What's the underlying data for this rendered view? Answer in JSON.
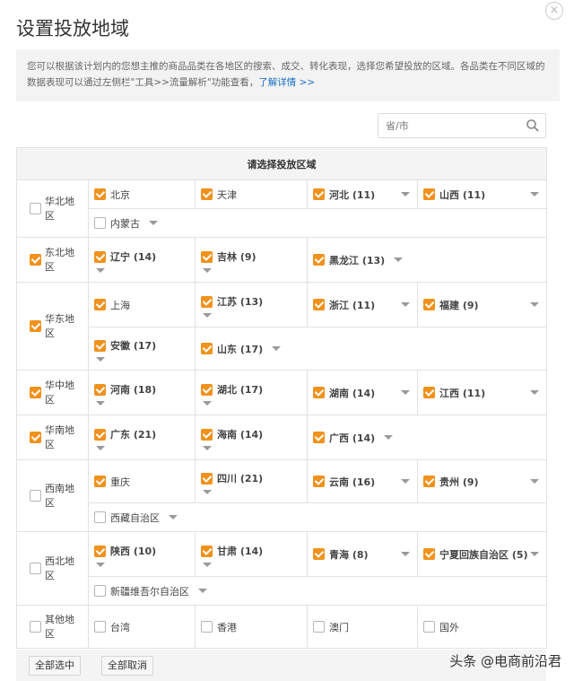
{
  "dialog": {
    "title": "设置投放地域",
    "close_glyph": "×",
    "notice_text": "您可以根据该计划内的您想主推的商品品类在各地区的搜索、成交、转化表现，选择您希望投放的区域。各品类在不同区域的数据表现可以通过左侧栏\"工具>>流量解析\"功能查看，",
    "notice_link": "了解详情 >>",
    "search_placeholder": "省/市",
    "table_header": "请选择投放区域",
    "select_all_label": "全部选中",
    "cancel_all_label": "全部取消",
    "watermark": "头条 @电商前沿君"
  },
  "groups": [
    {
      "label": "华北地区",
      "checked": false,
      "rows": [
        [
          {
            "name": "北京",
            "count": "",
            "checked": true,
            "caret": "none"
          },
          {
            "name": "天津",
            "count": "",
            "checked": true,
            "caret": "none"
          },
          {
            "name": "河北 (11)",
            "count": "",
            "checked": true,
            "caret": "right"
          },
          {
            "name": "山西 (11)",
            "count": "",
            "checked": true,
            "caret": "right"
          }
        ],
        [
          {
            "name": "内蒙古",
            "checked": false,
            "caret": "inline"
          }
        ]
      ]
    },
    {
      "label": "东北地区",
      "checked": true,
      "rows": [
        [
          {
            "name": "辽宁 (14)",
            "checked": true,
            "caret": "below"
          },
          {
            "name": "吉林 (9)",
            "checked": true,
            "caret": "below"
          },
          {
            "name": "黑龙江 (13)",
            "checked": true,
            "caret": "inline"
          }
        ]
      ]
    },
    {
      "label": "华东地区",
      "checked": true,
      "rows": [
        [
          {
            "name": "上海",
            "checked": true,
            "caret": "none"
          },
          {
            "name": "江苏 (13)",
            "checked": true,
            "caret": "below"
          },
          {
            "name": "浙江 (11)",
            "checked": true,
            "caret": "right"
          },
          {
            "name": "福建 (9)",
            "checked": true,
            "caret": "right"
          }
        ],
        [
          {
            "name": "安徽 (17)",
            "checked": true,
            "caret": "below"
          },
          {
            "name": "山东 (17)",
            "checked": true,
            "caret": "inline"
          }
        ]
      ]
    },
    {
      "label": "华中地区",
      "checked": true,
      "rows": [
        [
          {
            "name": "河南 (18)",
            "checked": true,
            "caret": "below"
          },
          {
            "name": "湖北 (17)",
            "checked": true,
            "caret": "below"
          },
          {
            "name": "湖南 (14)",
            "checked": true,
            "caret": "right"
          },
          {
            "name": "江西 (11)",
            "checked": true,
            "caret": "right"
          }
        ]
      ]
    },
    {
      "label": "华南地区",
      "checked": true,
      "rows": [
        [
          {
            "name": "广东 (21)",
            "checked": true,
            "caret": "below"
          },
          {
            "name": "海南 (14)",
            "checked": true,
            "caret": "below"
          },
          {
            "name": "广西 (14)",
            "checked": true,
            "caret": "inline"
          }
        ]
      ]
    },
    {
      "label": "西南地区",
      "checked": false,
      "rows": [
        [
          {
            "name": "重庆",
            "checked": true,
            "caret": "none"
          },
          {
            "name": "四川 (21)",
            "checked": true,
            "caret": "below"
          },
          {
            "name": "云南 (16)",
            "checked": true,
            "caret": "right"
          },
          {
            "name": "贵州 (9)",
            "checked": true,
            "caret": "right"
          }
        ],
        [
          {
            "name": "西藏自治区",
            "checked": false,
            "caret": "inline"
          }
        ]
      ]
    },
    {
      "label": "西北地区",
      "checked": false,
      "rows": [
        [
          {
            "name": "陕西 (10)",
            "checked": true,
            "caret": "below"
          },
          {
            "name": "甘肃 (14)",
            "checked": true,
            "caret": "below"
          },
          {
            "name": "青海 (8)",
            "checked": true,
            "caret": "right"
          },
          {
            "name": "宁夏回族自治区 (5)",
            "checked": true,
            "caret": "right"
          }
        ],
        [
          {
            "name": "新疆维吾尔自治区",
            "checked": false,
            "caret": "inline"
          }
        ]
      ]
    },
    {
      "label": "其他地区",
      "checked": false,
      "rows": [
        [
          {
            "name": "台湾",
            "checked": false,
            "caret": "none"
          },
          {
            "name": "香港",
            "checked": false,
            "caret": "none"
          },
          {
            "name": "澳门",
            "checked": false,
            "caret": "none"
          },
          {
            "name": "国外",
            "checked": false,
            "caret": "none"
          }
        ]
      ]
    }
  ]
}
